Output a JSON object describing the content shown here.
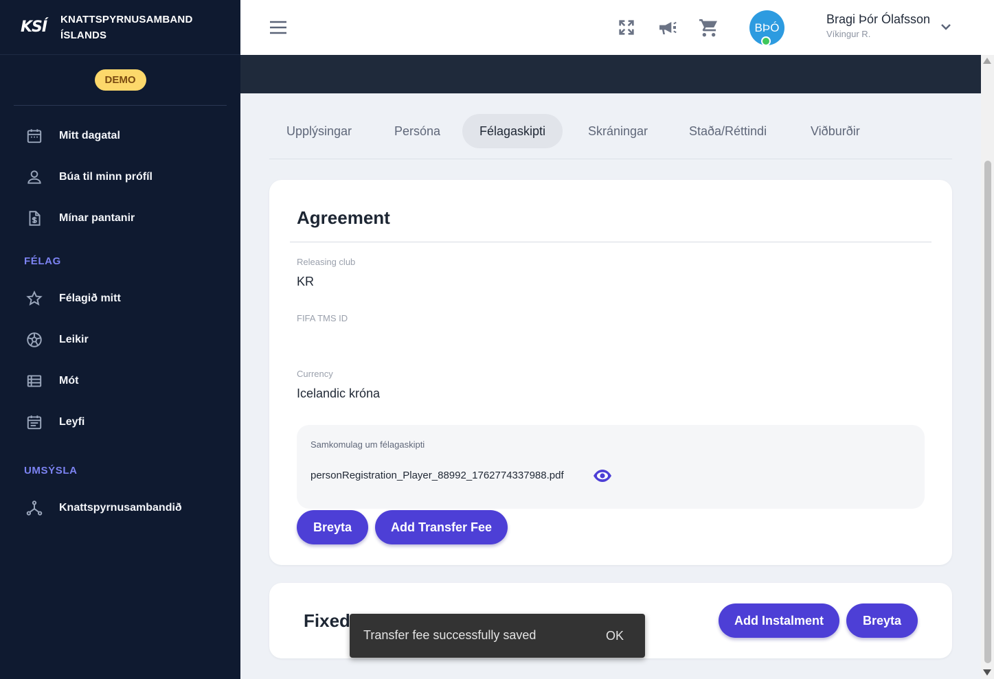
{
  "brand": {
    "logo": "KSÍ",
    "name_line1": "KNATTSPYRNUSAMBAND",
    "name_line2": "ÍSLANDS",
    "demo_badge": "DEMO"
  },
  "sidebar": {
    "items_top": [
      {
        "label": "Mitt dagatal",
        "icon": "calendar-icon"
      },
      {
        "label": "Búa til minn prófíl",
        "icon": "person-icon"
      },
      {
        "label": "Mínar pantanir",
        "icon": "invoice-icon"
      }
    ],
    "section_felag": "FÉLAG",
    "items_felag": [
      {
        "label": "Félagið mitt",
        "icon": "star-icon"
      },
      {
        "label": "Leikir",
        "icon": "soccer-ball-icon"
      },
      {
        "label": "Mót",
        "icon": "list-icon"
      },
      {
        "label": "Leyfi",
        "icon": "event-note-icon"
      }
    ],
    "section_umsysla": "UMSÝSLA",
    "items_umsysla": [
      {
        "label": "Knattspyrnusambandið",
        "icon": "hub-icon"
      }
    ]
  },
  "header": {
    "avatar_initials": "BÞÓ",
    "user_name": "Bragi Þór Ólafsson",
    "user_club": "Víkingur R.",
    "status_color": "#3ec75b"
  },
  "tabs": [
    {
      "label": "Upplýsingar"
    },
    {
      "label": "Persóna"
    },
    {
      "label": "Félagaskipti",
      "active": true
    },
    {
      "label": "Skráningar"
    },
    {
      "label": "Staða/Réttindi"
    },
    {
      "label": "Viðburðir"
    }
  ],
  "agreement": {
    "title": "Agreement",
    "releasing_club_label": "Releasing club",
    "releasing_club_value": "KR",
    "fifa_tms_label": "FIFA TMS ID",
    "fifa_tms_value": "",
    "currency_label": "Currency",
    "currency_value": "Icelandic króna",
    "doc_label": "Samkomulag um félagaskipti",
    "doc_file": "personRegistration_Player_88992_1762774337988.pdf",
    "edit_button": "Breyta",
    "add_fee_button": "Add Transfer Fee"
  },
  "fixed": {
    "title": "Fixed",
    "add_instalment_button": "Add Instalment",
    "edit_button": "Breyta"
  },
  "snackbar": {
    "message": "Transfer fee successfully saved",
    "action": "OK"
  },
  "colors": {
    "sidebar_bg": "#0f1a30",
    "accent": "#4d3fd6",
    "section_title": "#7c83f2",
    "demo_badge": "#fcd86b"
  }
}
